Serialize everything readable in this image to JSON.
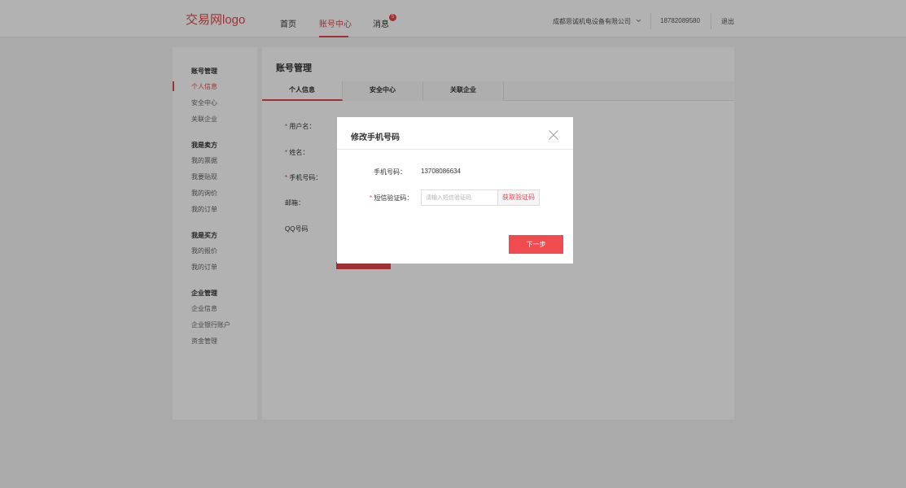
{
  "header": {
    "logo": "交易网logo",
    "nav": [
      {
        "label": "首页"
      },
      {
        "label": "账号中心"
      },
      {
        "label": "消息"
      }
    ],
    "message_badge": "5",
    "company": "成都思诚机电设备有限公司",
    "phone": "18782089580",
    "logout": "退出"
  },
  "sidebar": {
    "groups": [
      {
        "title": "账号管理",
        "items": [
          "个人信息",
          "安全中心",
          "关联企业"
        ]
      },
      {
        "title": "我是卖方",
        "items": [
          "我的票据",
          "我要贴现",
          "我的询价",
          "我的订单"
        ]
      },
      {
        "title": "我是买方",
        "items": [
          "我的报价",
          "我的订单"
        ]
      },
      {
        "title": "企业管理",
        "items": [
          "企业信息",
          "企业银行账户",
          "资金管理"
        ]
      }
    ],
    "active_item": "个人信息"
  },
  "main": {
    "title": "账号管理",
    "tabs": [
      {
        "label": "个人信息"
      },
      {
        "label": "安全中心"
      },
      {
        "label": "关联企业"
      }
    ],
    "form": {
      "required_mark": "*",
      "fields": [
        "用户名：",
        "姓名：",
        "手机号码：",
        "邮箱：",
        "QQ号码"
      ]
    }
  },
  "modal": {
    "title": "修改手机号码",
    "phone_label": "手机号码：",
    "phone_value": "13708086634",
    "required_mark": "*",
    "code_label": "短信验证码：",
    "code_placeholder": "请输入短信验证码",
    "get_code": "获取验证码",
    "next": "下一步"
  },
  "colors": {
    "accent": "#e2474b",
    "button": "#f04b4f",
    "overlay": "rgba(0,0,0,0.3)"
  }
}
